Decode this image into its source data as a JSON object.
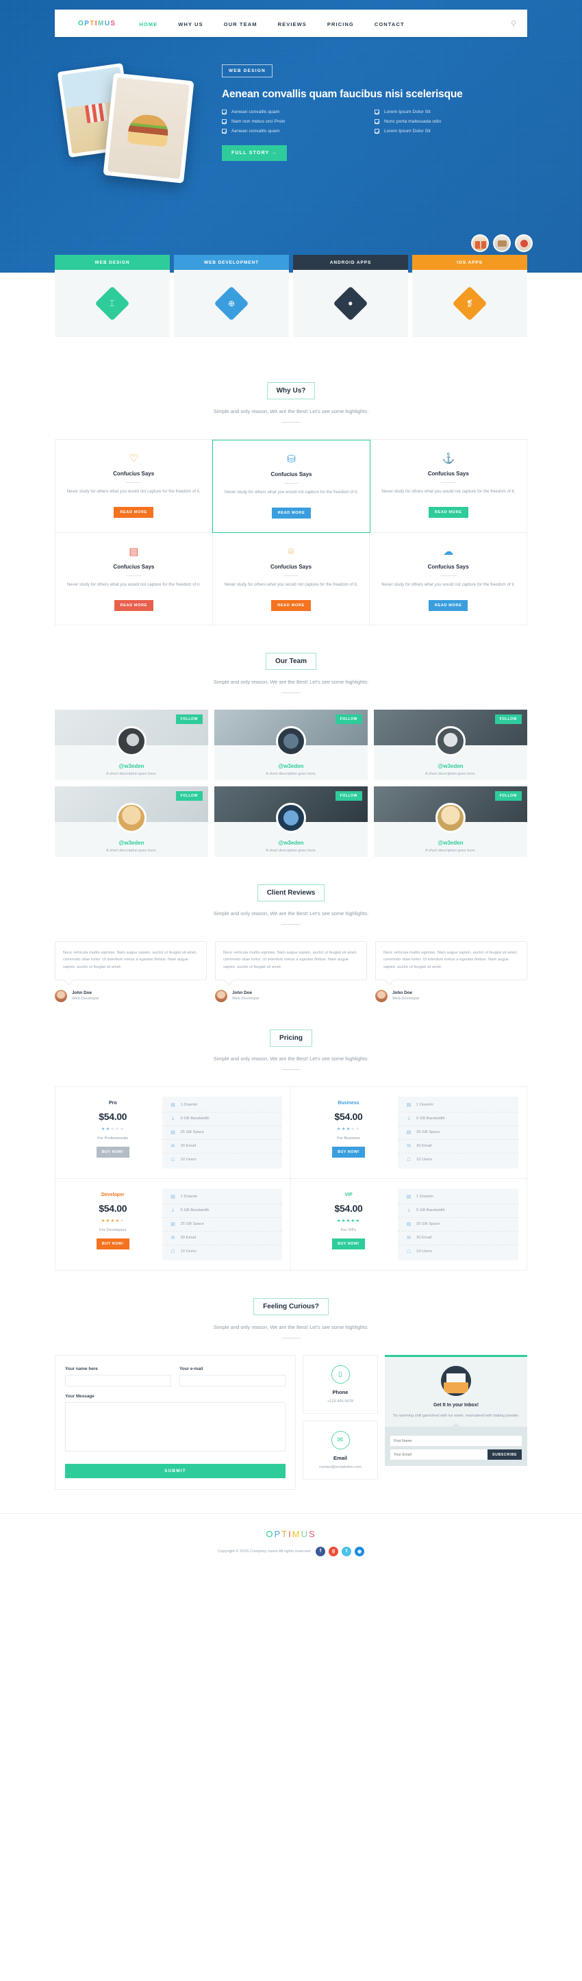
{
  "brand": {
    "name": "OPTIMUS",
    "letters": [
      "O",
      "P",
      "T",
      "I",
      "M",
      "U",
      "S"
    ]
  },
  "nav": {
    "items": [
      {
        "label": "HOME",
        "active": true
      },
      {
        "label": "WHY US",
        "active": false
      },
      {
        "label": "OUR TEAM",
        "active": false
      },
      {
        "label": "REVIEWS",
        "active": false
      },
      {
        "label": "PRICING",
        "active": false
      },
      {
        "label": "CONTACT",
        "active": false
      }
    ],
    "search_icon": "search-icon"
  },
  "hero": {
    "badge": "WEB DESIGN",
    "title": "Aenean convallis quam faucibus nisi scelerisque",
    "features": [
      "Aenean convallis quam",
      "Lorem Ipsum Dolor Sit",
      "Nam non metus orci Proin",
      "Nunc porta malesuada odio",
      "Aenean convallis quam",
      "Lorem Ipsum Dolor Sit"
    ],
    "cta": "FULL STORY →",
    "cta_color": "#2ecc9b"
  },
  "services": [
    {
      "label": "WEB DESIGN",
      "color": "#2ecc9b",
      "icon": "paint-roller-icon",
      "glyph": "⌶"
    },
    {
      "label": "WEB DEVELOPMENT",
      "color": "#3a9ede",
      "icon": "globe-icon",
      "glyph": "⊕"
    },
    {
      "label": "ANDROID APPS",
      "color": "#2b3b4c",
      "icon": "android-icon",
      "glyph": "●"
    },
    {
      "label": "IOS APPS",
      "color": "#f49a21",
      "icon": "apple-icon",
      "glyph": "❡"
    }
  ],
  "why_us": {
    "title": "Why Us?",
    "subtitle": "Simple and only reason, We are the Best! Let's see some highlights:",
    "cards": [
      {
        "icon": "heart-icon",
        "glyph": "♡",
        "icon_color": "#f0a33a",
        "title": "Confucius Says",
        "text": "Never study for others what you would not capture for the freedom of it.",
        "button": "READ MORE",
        "button_color": "#f4731f",
        "featured": false
      },
      {
        "icon": "database-icon",
        "glyph": "⛁",
        "icon_color": "#3a9ede",
        "title": "Confucius Says",
        "text": "Never study for others what you would not capture for the freedom of it.",
        "button": "READ MORE",
        "button_color": "#3a9ede",
        "featured": true
      },
      {
        "icon": "anchor-icon",
        "glyph": "⚓",
        "icon_color": "#2ecc9b",
        "title": "Confucius Says",
        "text": "Never study for others what you would not capture for the freedom of it.",
        "button": "READ MORE",
        "button_color": "#2ecc9b",
        "featured": false
      },
      {
        "icon": "book-icon",
        "glyph": "▤",
        "icon_color": "#e8604c",
        "title": "Confucius Says",
        "text": "Never study for others what you would not capture for the freedom of it.",
        "button": "READ MORE",
        "button_color": "#e8604c",
        "featured": false
      },
      {
        "icon": "headphones-icon",
        "glyph": "⌾",
        "icon_color": "#f0a33a",
        "title": "Confucius Says",
        "text": "Never study for others what you would not capture for the freedom of it.",
        "button": "READ MORE",
        "button_color": "#f4731f",
        "featured": false
      },
      {
        "icon": "cloud-icon",
        "glyph": "☁",
        "icon_color": "#3a9ede",
        "title": "Confucius Says",
        "text": "Never study for others what you would not capture for the freedom of it.",
        "button": "READ MORE",
        "button_color": "#3a9ede",
        "featured": false
      }
    ]
  },
  "team": {
    "title": "Our Team",
    "subtitle": "Simple and only reason, We are the Best! Let's see some highlights:",
    "follow_label": "FOLLOW",
    "members": [
      {
        "handle": "@w3eden",
        "desc": "A short description goes here."
      },
      {
        "handle": "@w3eden",
        "desc": "A short description goes here."
      },
      {
        "handle": "@w3eden",
        "desc": "A short description goes here."
      },
      {
        "handle": "@w3eden",
        "desc": "A short description goes here."
      },
      {
        "handle": "@w3eden",
        "desc": "A short description goes here."
      },
      {
        "handle": "@w3eden",
        "desc": "A short description goes here."
      }
    ]
  },
  "reviews": {
    "title": "Client Reviews",
    "subtitle": "Simple and only reason, We are the Best! Let's see some highlights:",
    "items": [
      {
        "text": "Nunc vehicula mattis egestas. Nam augue sapien, auctor ut feugiat sit amet, commodo vitae tortor. Ut interdum metus a egestas finibus. Nam augue sapien, auctor ut feugiat sit amet.",
        "name": "John Doe",
        "role": "Web Developer"
      },
      {
        "text": "Nunc vehicula mattis egestas. Nam augue sapien, auctor ut feugiat sit amet, commodo vitae tortor. Ut interdum metus a egestas finibus. Nam augue sapien, auctor ut feugiat sit amet.",
        "name": "John Doe",
        "role": "Web Developer"
      },
      {
        "text": "Nunc vehicula mattis egestas. Nam augue sapien, auctor ut feugiat sit amet, commodo vitae tortor. Ut interdum metus a egestas finibus. Nam augue sapien, auctor ut feugiat sit amet.",
        "name": "John Doe",
        "role": "Web Developer"
      }
    ]
  },
  "pricing": {
    "title": "Pricing",
    "subtitle": "Simple and only reason, We are the Best! Let's see some highlights:",
    "buy_label": "BUY NOW!",
    "features": [
      {
        "icon": "server-icon",
        "glyph": "▤",
        "label": "1 Doamin"
      },
      {
        "icon": "download-icon",
        "glyph": "⤓",
        "label": "5 GB Bandwidth"
      },
      {
        "icon": "drive-icon",
        "glyph": "▤",
        "label": "25 GB Space"
      },
      {
        "icon": "envelope-icon",
        "glyph": "✉",
        "label": "30 Email"
      },
      {
        "icon": "user-icon",
        "glyph": "☖",
        "label": "10 Users"
      }
    ],
    "plans": [
      {
        "name": "Pro",
        "price": "$54.00",
        "stars_filled": 2,
        "stars_total": 5,
        "for": "For Professionals",
        "name_color": "#2b3a4a",
        "btn_color": "#b3bcc4",
        "star_color": "#7fb9e8"
      },
      {
        "name": "Business",
        "price": "$54.00",
        "stars_filled": 3,
        "stars_total": 5,
        "for": "For Business",
        "name_color": "#3a9ede",
        "btn_color": "#3a9ede",
        "star_color": "#7fb9e8"
      },
      {
        "name": "Developer",
        "price": "$54.00",
        "stars_filled": 4,
        "stars_total": 5,
        "for": "For Developers",
        "name_color": "#f4731f",
        "btn_color": "#f4731f",
        "star_color": "#f0a33a"
      },
      {
        "name": "VIP",
        "price": "$54.00",
        "stars_filled": 5,
        "stars_total": 5,
        "for": "For VIPs",
        "name_color": "#2ecc9b",
        "btn_color": "#2ecc9b",
        "star_color": "#2ecc9b"
      }
    ]
  },
  "contact": {
    "title": "Feeling Curious?",
    "subtitle": "Simple and only reason, We are the Best! Let's see some highlights:",
    "form": {
      "name_label": "Your name here",
      "email_label": "Your e-mail",
      "message_label": "Your Message",
      "name_value": "",
      "email_value": "",
      "message_value": "",
      "submit": "SUBMIT"
    },
    "phone": {
      "icon": "phone-icon",
      "glyph": "▯",
      "title": "Phone",
      "value": "+123-456-5678"
    },
    "email": {
      "icon": "envelope-icon",
      "glyph": "✉",
      "title": "Email",
      "value": "contact@scripteden.com"
    },
    "newsletter": {
      "icon": "mail-open-icon",
      "title": "Get It In your Inbox!",
      "text": "Try warming chili garnished with ice water, marinateed with baking powder.",
      "first_name_placeholder": "First Name",
      "email_placeholder": "Your Email",
      "button": "SUBSCRIBE"
    }
  },
  "footer": {
    "logo": "OPTIMUS",
    "copyright": "Copyright © 2016.Company name All rights reserved.",
    "socials": [
      {
        "name": "facebook-icon",
        "glyph": "f",
        "color": "#3b5998"
      },
      {
        "name": "google-plus-icon",
        "glyph": "g",
        "color": "#e8503a"
      },
      {
        "name": "twitter-icon",
        "glyph": "t",
        "color": "#4ac3e8"
      },
      {
        "name": "dribbble-icon",
        "glyph": "◉",
        "color": "#1b8ae0"
      }
    ]
  }
}
